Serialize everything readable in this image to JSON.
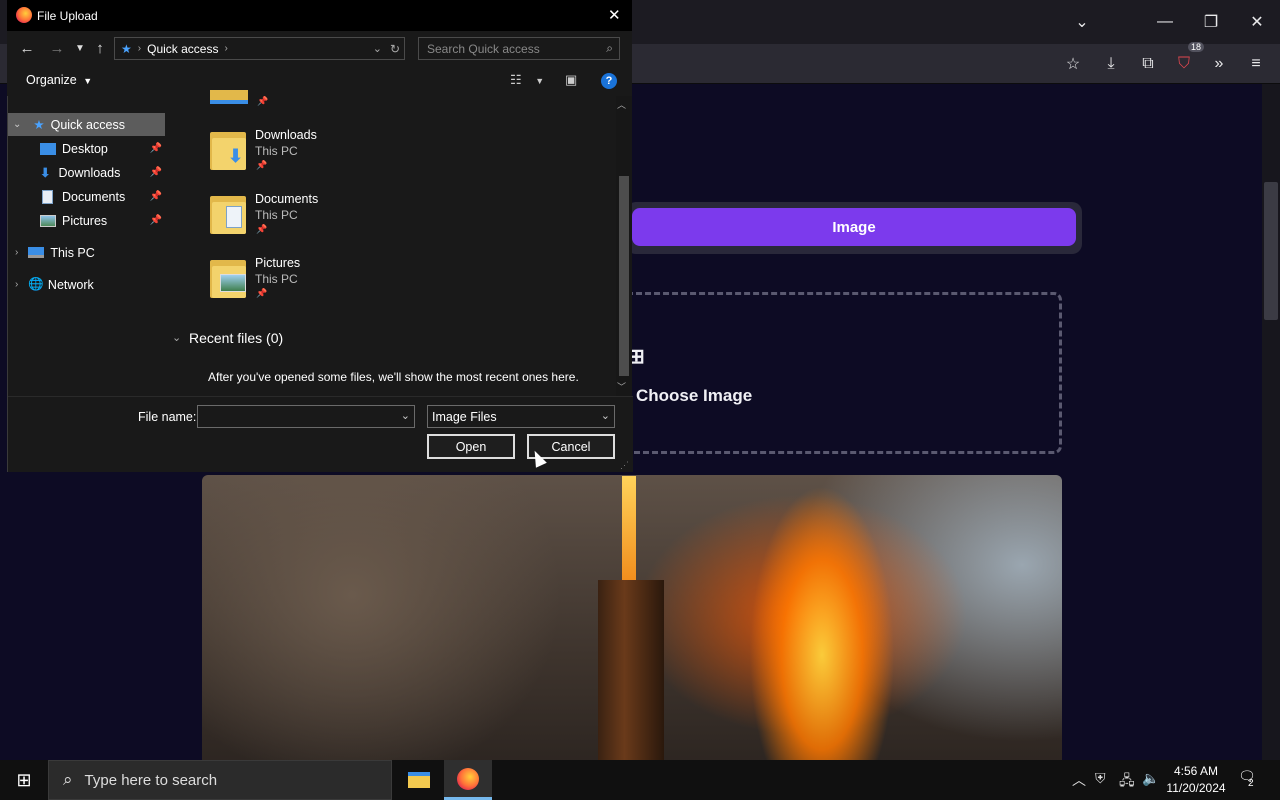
{
  "dialog": {
    "title": "File Upload",
    "close_glyph": "✕",
    "address": {
      "location": "Quick access"
    },
    "search": {
      "placeholder": "Search Quick access"
    },
    "organize_label": "Organize",
    "help_glyph": "?",
    "nav_pane": {
      "quick_access": "Quick access",
      "items": [
        {
          "label": "Desktop",
          "icon": "desktop-icon"
        },
        {
          "label": "Downloads",
          "icon": "downloads-icon"
        },
        {
          "label": "Documents",
          "icon": "documents-icon"
        },
        {
          "label": "Pictures",
          "icon": "pictures-icon"
        }
      ],
      "this_pc": "This PC",
      "network": "Network"
    },
    "folders": [
      {
        "name": "Downloads",
        "location": "This PC"
      },
      {
        "name": "Documents",
        "location": "This PC"
      },
      {
        "name": "Pictures",
        "location": "This PC"
      }
    ],
    "recent_header": "Recent files (0)",
    "recent_message": "After you've opened some files, we'll show the most recent ones here.",
    "file_name_label": "File name:",
    "file_name_value": "",
    "file_type": "Image Files",
    "open_label": "Open",
    "cancel_label": "Cancel"
  },
  "browser": {
    "extension_badge": "18"
  },
  "page": {
    "image_tab_label": "Image",
    "choose_image_label": "Choose Image"
  },
  "taskbar": {
    "search_placeholder": "Type here to search",
    "time": "4:56 AM",
    "date": "11/20/2024",
    "notification_count": "2"
  },
  "colors": {
    "accent_purple": "#7c3aed",
    "page_background": "#0d0b24",
    "dialog_background": "#191919",
    "selection": "#5c5c5c"
  }
}
